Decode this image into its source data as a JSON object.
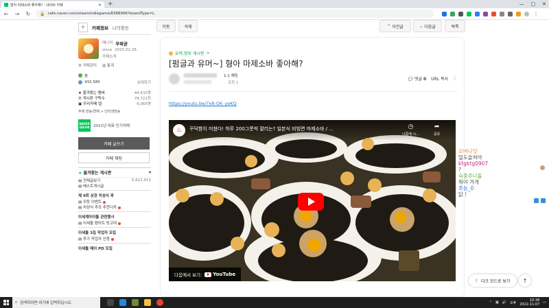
{
  "browser": {
    "tab_title": "형아 마제소바 좋아해? : 네이버 카페",
    "tab_close": "✕",
    "new_tab": "+",
    "url": "cafe.naver.com/steamindiegame/8388996?boardType=L",
    "window_controls": [
      "—",
      "□",
      "✕"
    ]
  },
  "sidebar": {
    "tabs": [
      "카페정보",
      "나의활동"
    ],
    "profile": {
      "role_label": "매니저",
      "name": "우왁굳",
      "since_label": "since",
      "since_date": "2015.02.26.",
      "intro_label": "카페소개"
    },
    "admin_links": [
      "카페관리",
      "통계"
    ],
    "level_label": "숲",
    "members_count": "432,580",
    "invite_label": "초대하기",
    "stats": [
      {
        "label": "즐겨찾는 멤버",
        "value": "44,432명"
      },
      {
        "label": "게시판 구독수",
        "value": "79,721회"
      },
      {
        "label": "우리카페 앱",
        "value": "6,065명"
      }
    ],
    "tags": "주제 방송/연예 > 인터넷방송",
    "badge_text": "NAVER 대표카페",
    "badge_label": "2021년 대표 인기카페",
    "write_button": "카페 글쓰기",
    "chat_button": "카페 채팅",
    "favorites_title": "즐겨찾는 게시판",
    "boards": [
      {
        "label": "전체글보기",
        "count": "6,621,413"
      },
      {
        "label": "베스트게시글",
        "count": ""
      }
    ],
    "groups": [
      {
        "title": "제 9회 상관 치성식 후",
        "items": []
      },
      {
        "title": "",
        "items": [
          {
            "label": "무등 이벤트",
            "new": true
          },
          {
            "label": "치성식 추모 추천디카",
            "new": true
          }
        ]
      },
      {
        "title": "이세계아이돌 관련행사",
        "items": [
          {
            "label": "이세돌 팬아트 빙고대",
            "new": true
          }
        ]
      },
      {
        "title": "이세돌 3집 작업자 모집",
        "items": [
          {
            "label": "추가 작업자 신청",
            "new": true
          }
        ]
      },
      {
        "title": "이세돌 메이 PD 모집",
        "items": []
      }
    ]
  },
  "main": {
    "buttons": {
      "move": "이동",
      "delete": "삭제",
      "prev": "이전글",
      "next": "다음글",
      "list": "목록"
    },
    "board_link": "유머,정보 게시판",
    "title": "[펌글과 유머~] 형아 마제소바 좋아해?",
    "author_grade": "1:1 채팅",
    "views_label": "조회 1",
    "comments_label": "댓글",
    "comments_count": "0",
    "url_copy": "URL 복사",
    "more": "⋮",
    "youtube_link": "https://youtu.be/7x8-O6_yeKQ",
    "video": {
      "title": "꾸덕함이 미쳤다! 하루 200그릇씩 팔리는? 일본식 비빔면 마제소바 / ...",
      "watch_later": "나중에 시...",
      "share": "공유",
      "watch_on": "다음에서 보기:",
      "yt": "YouTube"
    }
  },
  "chat": {
    "lines": [
      {
        "text": "오버나잇",
        "cls": "c-orange"
      },
      {
        "text": "덜도슬쳐야",
        "cls": "c-dark"
      },
      {
        "text": "ktgktg0907",
        "cls": "c-pink"
      },
      {
        "text": "?",
        "cls": "c-dark"
      },
      {
        "text": "숙중주나돌",
        "cls": "c-green"
      },
      {
        "text": "줘야 겨게",
        "cls": "c-dark"
      },
      {
        "text": "주농_0",
        "cls": "c-blue"
      },
      {
        "text": "닭 !",
        "cls": "c-dark"
      }
    ]
  },
  "floating": {
    "dark_mode": "다크 모드로 보기",
    "top": "↑"
  },
  "taskbar": {
    "search_placeholder": "검색하려면 여기에 입력하십시오.",
    "lang": "오후",
    "time": "10:38",
    "date": "2022-11-07"
  }
}
